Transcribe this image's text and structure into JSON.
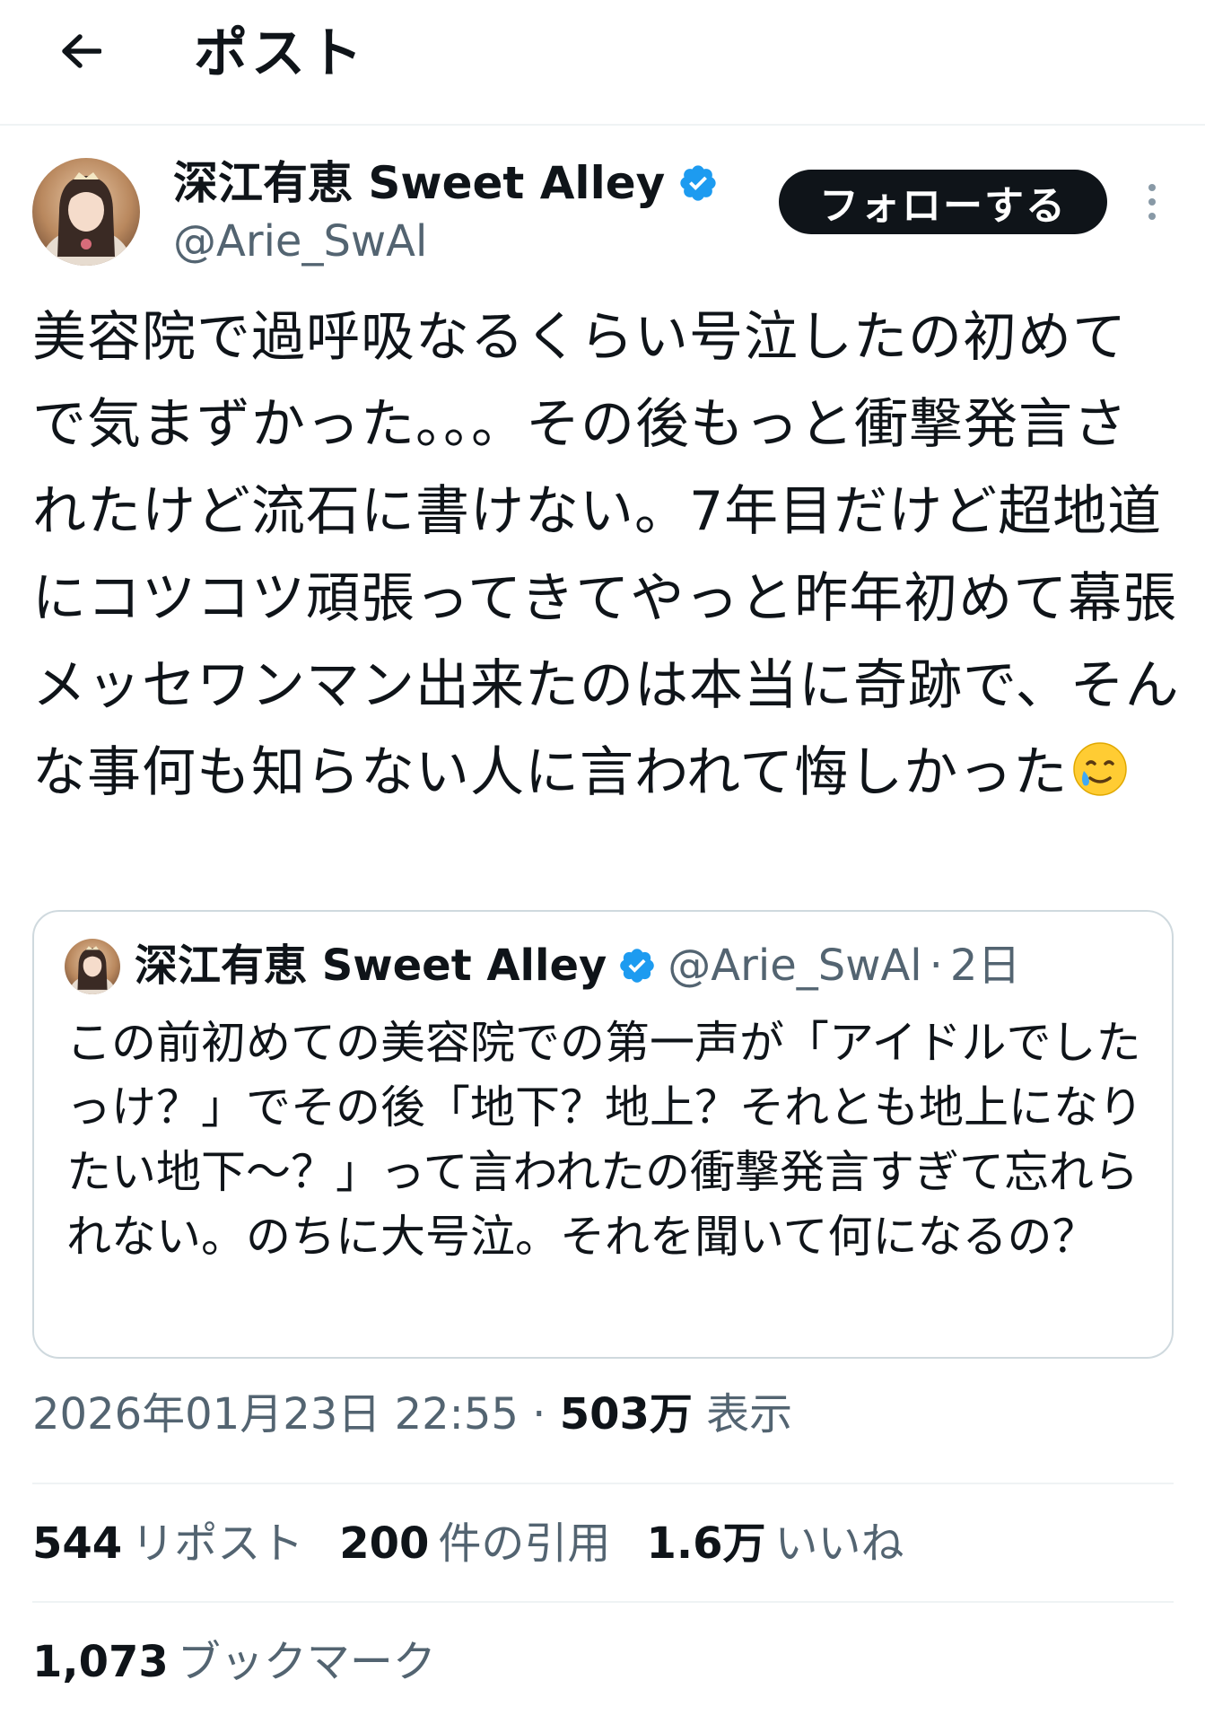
{
  "header": {
    "title": "ポスト"
  },
  "author": {
    "name": "深江有恵 Sweet Alley",
    "handle": "@Arie_SwAl",
    "follow_label": "フォローする"
  },
  "post": {
    "text": "美容院で過呼吸なるくらい号泣したの初めてで気まずかった。。。その後もっと衝撃発言されたけど流石に書けない。7年目だけど超地道にコツコツ頑張ってきてやっと昨年初めて幕張メッセワンマン出来たのは本当に奇跡で、そんな事何も知らない人に言われて悔しかった",
    "emoji": "smiling-face-with-tear"
  },
  "quote": {
    "name": "深江有恵 Sweet Alley",
    "handle": "@Arie_SwAl",
    "age": "2日",
    "text": "この前初めての美容院での第一声が「アイドルでしたっけ？」でその後「地下？地上？それとも地上になりたい地下〜？」って言われたの衝撃発言すぎて忘れられない。のちに大号泣。それを聞いて何になるの？"
  },
  "meta": {
    "timestamp": "2026年01月23日 22:55",
    "separator": "·",
    "views_count": "503万",
    "views_label": "表示"
  },
  "stats": {
    "reposts_count": "544",
    "reposts_label": "リポスト",
    "quotes_count": "200",
    "quotes_label": "件の引用",
    "likes_count": "1.6万",
    "likes_label": "いいね",
    "bookmarks_count": "1,073",
    "bookmarks_label": "ブックマーク"
  },
  "colors": {
    "text": "#0f1419",
    "secondary": "#536471",
    "verified": "#1d9bf0",
    "border": "#cfd9de"
  }
}
